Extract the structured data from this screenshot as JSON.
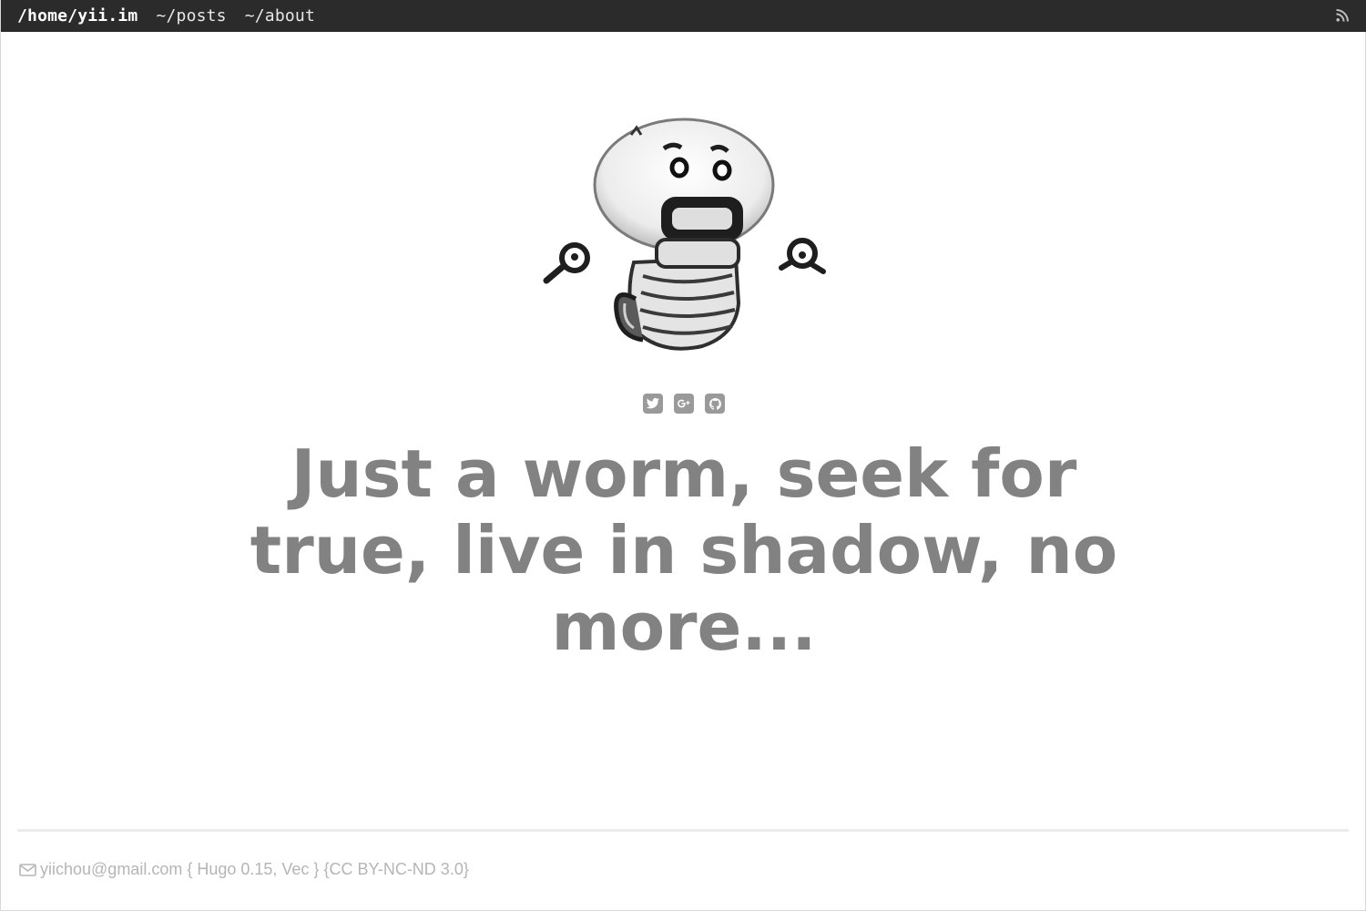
{
  "nav": {
    "brand": "/home/yii.im",
    "links": [
      "~/posts",
      "~/about"
    ],
    "rss_icon": "rss-icon"
  },
  "social": {
    "icons": [
      "twitter-icon",
      "google-plus-icon",
      "github-icon"
    ]
  },
  "hero": {
    "tagline": "Just a worm, seek for true, live in shadow, no more..."
  },
  "footer": {
    "mail_icon": "envelope-icon",
    "email": "yiichou@gmail.com",
    "engine": "{ Hugo 0.15, Vec }",
    "license": "{CC BY-NC-ND 3.0}"
  },
  "colors": {
    "topbar": "#2b2b2b",
    "tagline": "#828282",
    "footer_text": "#b5b5b5",
    "icon": "#9a9a9a"
  }
}
